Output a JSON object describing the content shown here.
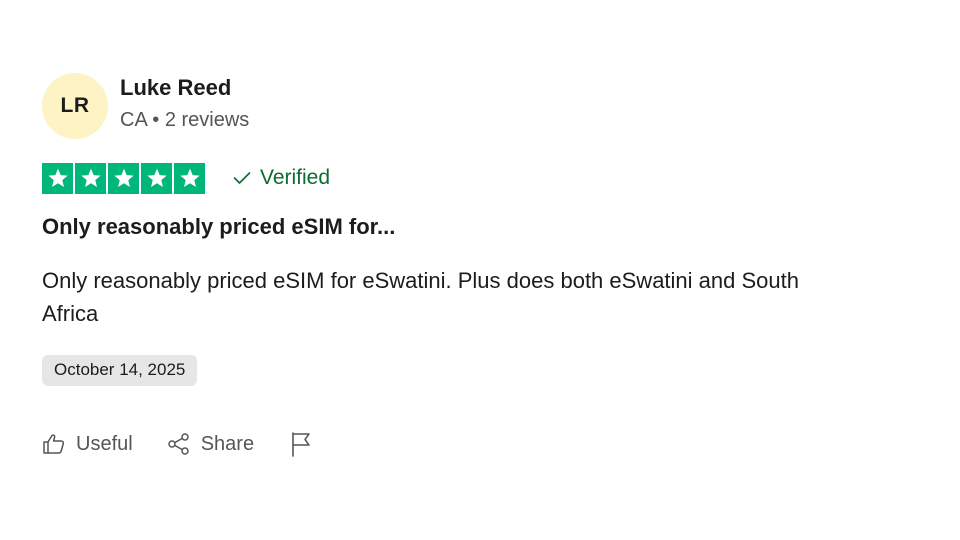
{
  "reviewer": {
    "initials": "LR",
    "name": "Luke Reed",
    "country": "CA",
    "separator": "•",
    "reviews": "2 reviews",
    "avatar_bg": "#fdf3c4"
  },
  "rating": {
    "stars": 5,
    "max_stars": 5,
    "star_color": "#00b67a",
    "verified_label": "Verified",
    "verified_color": "#0f6a33",
    "verified_icon": "checkmark-icon"
  },
  "review": {
    "title": "Only reasonably priced eSIM for...",
    "body": "Only reasonably priced eSIM for eSwatini. Plus does both eSwatini and South Africa",
    "date": "October 14, 2025"
  },
  "actions": {
    "useful_label": "Useful",
    "useful_icon": "thumbs-up-icon",
    "share_label": "Share",
    "share_icon": "share-icon",
    "report_icon": "flag-icon"
  }
}
